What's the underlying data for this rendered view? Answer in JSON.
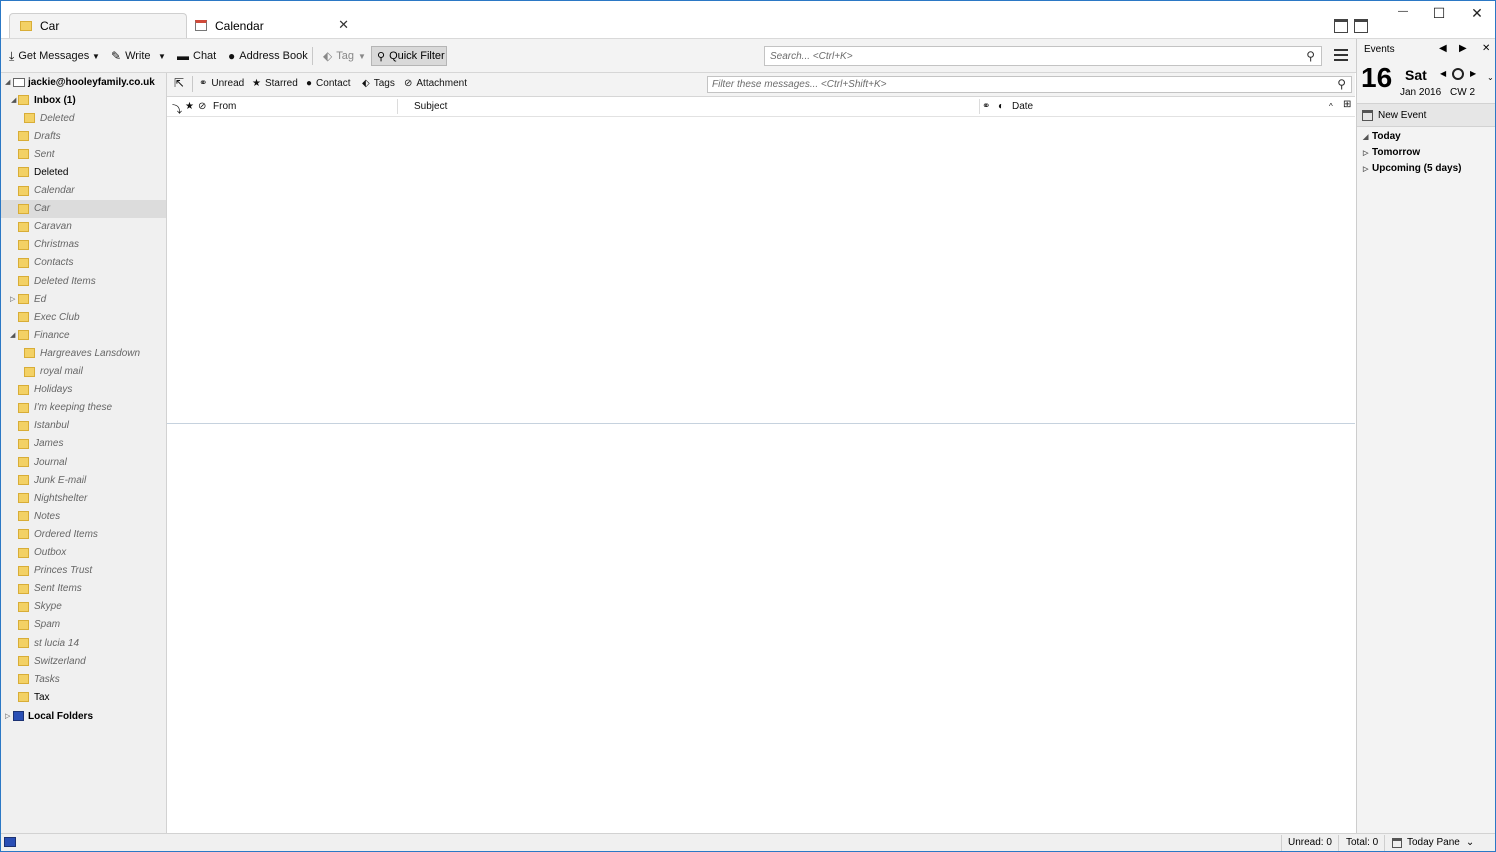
{
  "tabs": [
    {
      "label": "Car",
      "icon": "folder-icon",
      "active": true
    },
    {
      "label": "Calendar",
      "icon": "calendar-icon",
      "active": false
    }
  ],
  "window_controls": {
    "minimize": "—",
    "maximize": "☐",
    "close": "✕"
  },
  "toolbar": {
    "get_messages": "Get Messages",
    "write": "Write",
    "chat": "Chat",
    "address_book": "Address Book",
    "tag": "Tag",
    "quick_filter": "Quick Filter",
    "search_placeholder": "Search... <Ctrl+K>"
  },
  "folders": {
    "account": "jackie@hooleyfamily.co.uk",
    "items": [
      {
        "label": "Inbox (1)",
        "style": "bold"
      },
      {
        "label": "Deleted",
        "style": "italic",
        "indent": 2
      },
      {
        "label": "Drafts",
        "style": "italic"
      },
      {
        "label": "Sent",
        "style": "italic"
      },
      {
        "label": "Deleted",
        "style": "normal"
      },
      {
        "label": "Calendar",
        "style": "italic"
      },
      {
        "label": "Car",
        "style": "italic",
        "selected": true
      },
      {
        "label": "Caravan",
        "style": "italic"
      },
      {
        "label": "Christmas",
        "style": "italic"
      },
      {
        "label": "Contacts",
        "style": "italic"
      },
      {
        "label": "Deleted Items",
        "style": "italic"
      },
      {
        "label": "Ed",
        "style": "italic",
        "collapsed": true
      },
      {
        "label": "Exec Club",
        "style": "italic"
      },
      {
        "label": "Finance",
        "style": "italic",
        "expanded": true
      },
      {
        "label": "Hargreaves Lansdown",
        "style": "italic",
        "indent": 2
      },
      {
        "label": "royal mail",
        "style": "italic",
        "indent": 2
      },
      {
        "label": "Holidays",
        "style": "italic"
      },
      {
        "label": "I'm keeping these",
        "style": "italic"
      },
      {
        "label": "Istanbul",
        "style": "italic"
      },
      {
        "label": "James",
        "style": "italic"
      },
      {
        "label": "Journal",
        "style": "italic"
      },
      {
        "label": "Junk E-mail",
        "style": "italic"
      },
      {
        "label": "Nightshelter",
        "style": "italic"
      },
      {
        "label": "Notes",
        "style": "italic"
      },
      {
        "label": "Ordered Items",
        "style": "italic"
      },
      {
        "label": "Outbox",
        "style": "italic"
      },
      {
        "label": "Princes Trust",
        "style": "italic"
      },
      {
        "label": "Sent Items",
        "style": "italic"
      },
      {
        "label": "Skype",
        "style": "italic"
      },
      {
        "label": "Spam",
        "style": "italic"
      },
      {
        "label": "st lucia 14",
        "style": "italic"
      },
      {
        "label": "Switzerland",
        "style": "italic"
      },
      {
        "label": "Tasks",
        "style": "italic"
      },
      {
        "label": "Tax",
        "style": "normal"
      }
    ],
    "local_folders": "Local Folders"
  },
  "quick_filter_bar": {
    "unread": "Unread",
    "starred": "Starred",
    "contact": "Contact",
    "tags": "Tags",
    "attachment": "Attachment",
    "filter_placeholder": "Filter these messages... <Ctrl+Shift+K>"
  },
  "thread_columns": {
    "from": "From",
    "subject": "Subject",
    "date": "Date"
  },
  "today_pane": {
    "header": "Events",
    "day": "16",
    "weekday": "Sat",
    "month_year": "Jan 2016",
    "calendar_week": "CW 2",
    "new_event": "New Event",
    "groups": [
      "Today",
      "Tomorrow",
      "Upcoming (5 days)"
    ]
  },
  "status_bar": {
    "unread": "Unread: 0",
    "total": "Total: 0",
    "today_pane": "Today Pane"
  }
}
